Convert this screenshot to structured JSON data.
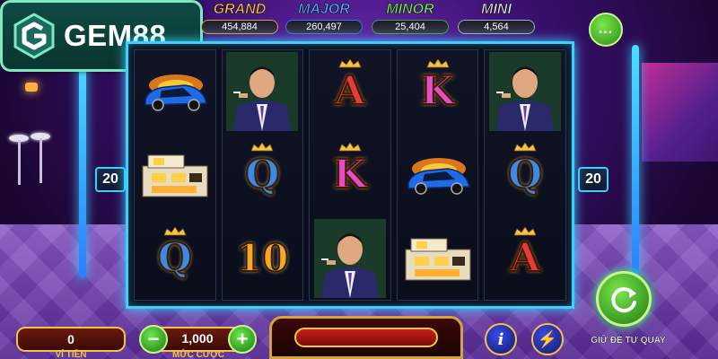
{
  "brand": {
    "name": "GEM88"
  },
  "jackpots": [
    {
      "title": "GRAND",
      "value": "454,884",
      "color": "#f4c247"
    },
    {
      "title": "MAJOR",
      "value": "260,497",
      "color": "#5aa8ff"
    },
    {
      "title": "MINOR",
      "value": "25,404",
      "color": "#7de85a"
    },
    {
      "title": "MINI",
      "value": "4,564",
      "color": "#e6e6f0"
    }
  ],
  "menu": {
    "label": "..."
  },
  "paylines": {
    "left": "20",
    "right": "20"
  },
  "reels": [
    [
      "car",
      "house",
      "Q"
    ],
    [
      "man",
      "Q",
      "10"
    ],
    [
      "A",
      "K",
      "man"
    ],
    [
      "K",
      "car",
      "house"
    ],
    [
      "man",
      "Q",
      "A"
    ]
  ],
  "symbol_names": {
    "car": "blue sports car",
    "house": "modern mansion",
    "man": "businessman",
    "A": "A",
    "K": "K",
    "Q": "Q",
    "10": "10"
  },
  "wallet": {
    "value": "0",
    "label": "VÍ TIỀN"
  },
  "bet": {
    "value": "1,000",
    "label": "MỨC CƯỢC",
    "minus": "−",
    "plus": "+"
  },
  "buttons": {
    "info": "i",
    "turbo": "⚡",
    "auto_label": "GIỮ ĐỂ TỰ QUAY"
  }
}
